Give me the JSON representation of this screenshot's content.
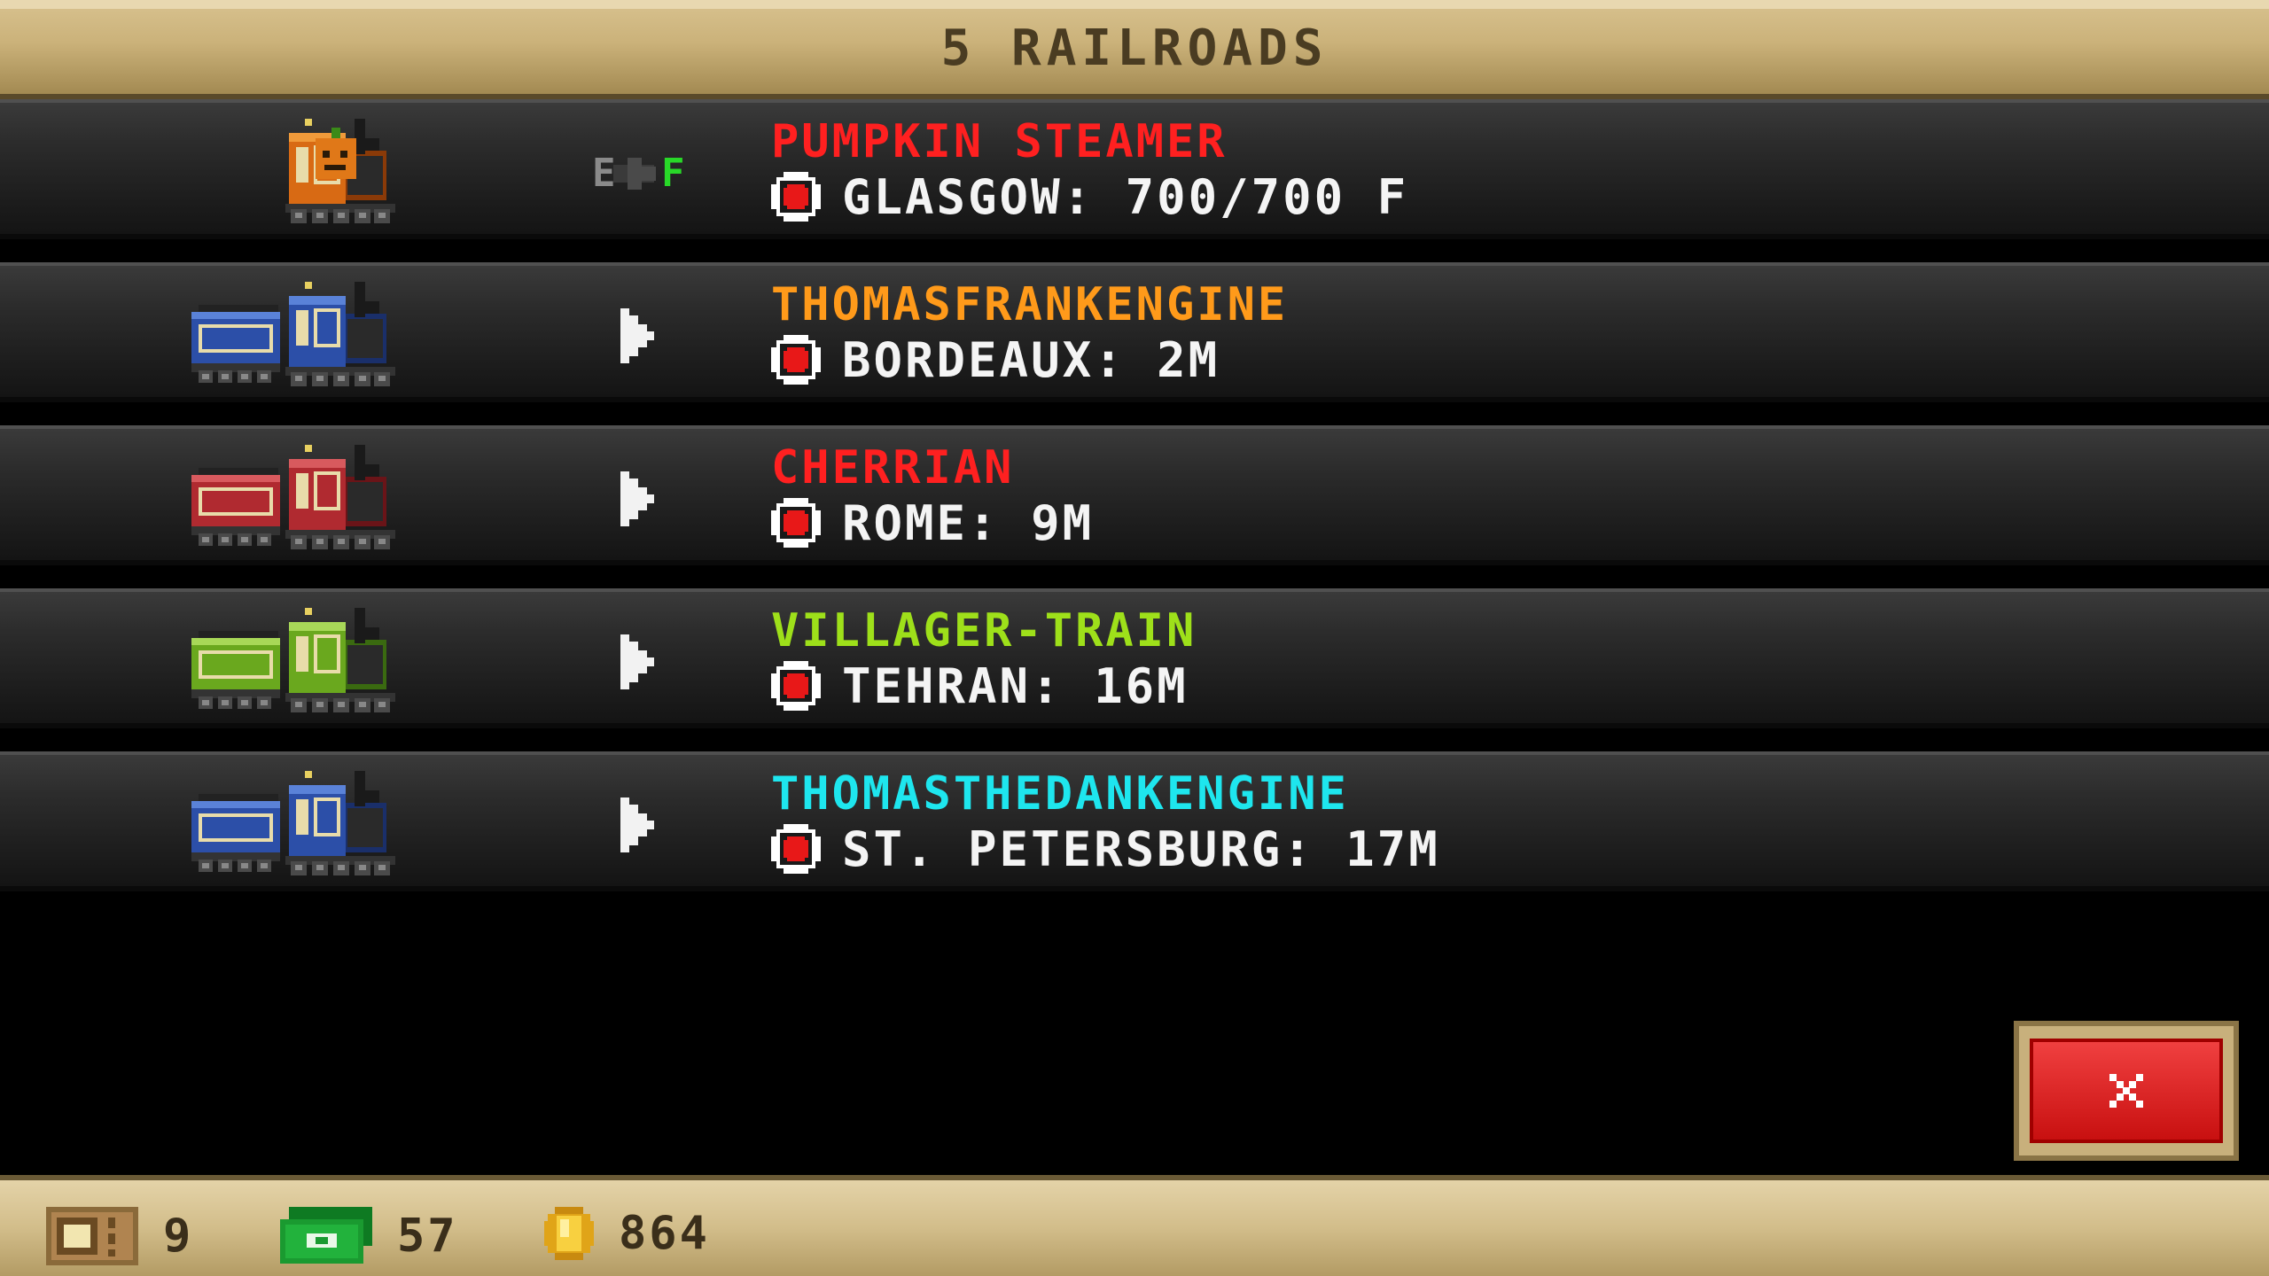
{
  "header": {
    "title": "5 RAILROADS"
  },
  "railroads": [
    {
      "name": "PUMPKIN STEAMER",
      "name_color": "#ff2020",
      "destination": "GLASGOW: 700/700 F",
      "train": "pumpkin",
      "action": "fuel",
      "fuel_from": "E",
      "fuel_to": "F"
    },
    {
      "name": "THOMASFRANKENGINE",
      "name_color": "#ff9a1a",
      "destination": "BORDEAUX: 2M",
      "train": "blue",
      "action": "arrow"
    },
    {
      "name": "CHERRIAN",
      "name_color": "#ff2020",
      "destination": "ROME: 9M",
      "train": "red",
      "action": "arrow"
    },
    {
      "name": "VILLAGER-TRAIN",
      "name_color": "#9ee01a",
      "destination": "TEHRAN: 16M",
      "train": "green",
      "action": "arrow"
    },
    {
      "name": "THOMASTHEDANKENGINE",
      "name_color": "#1ee6ee",
      "destination": "ST. PETERSBURG: 17M",
      "train": "blue",
      "action": "arrow"
    }
  ],
  "footer": {
    "tickets": "9",
    "cash": "57",
    "coins": "864"
  },
  "icons": {
    "close": "close-x-icon",
    "ticket": "ticket-icon",
    "cash": "cash-icon",
    "coin": "coin-icon",
    "destination": "destination-pin-icon",
    "arrow": "play-arrow-icon"
  }
}
